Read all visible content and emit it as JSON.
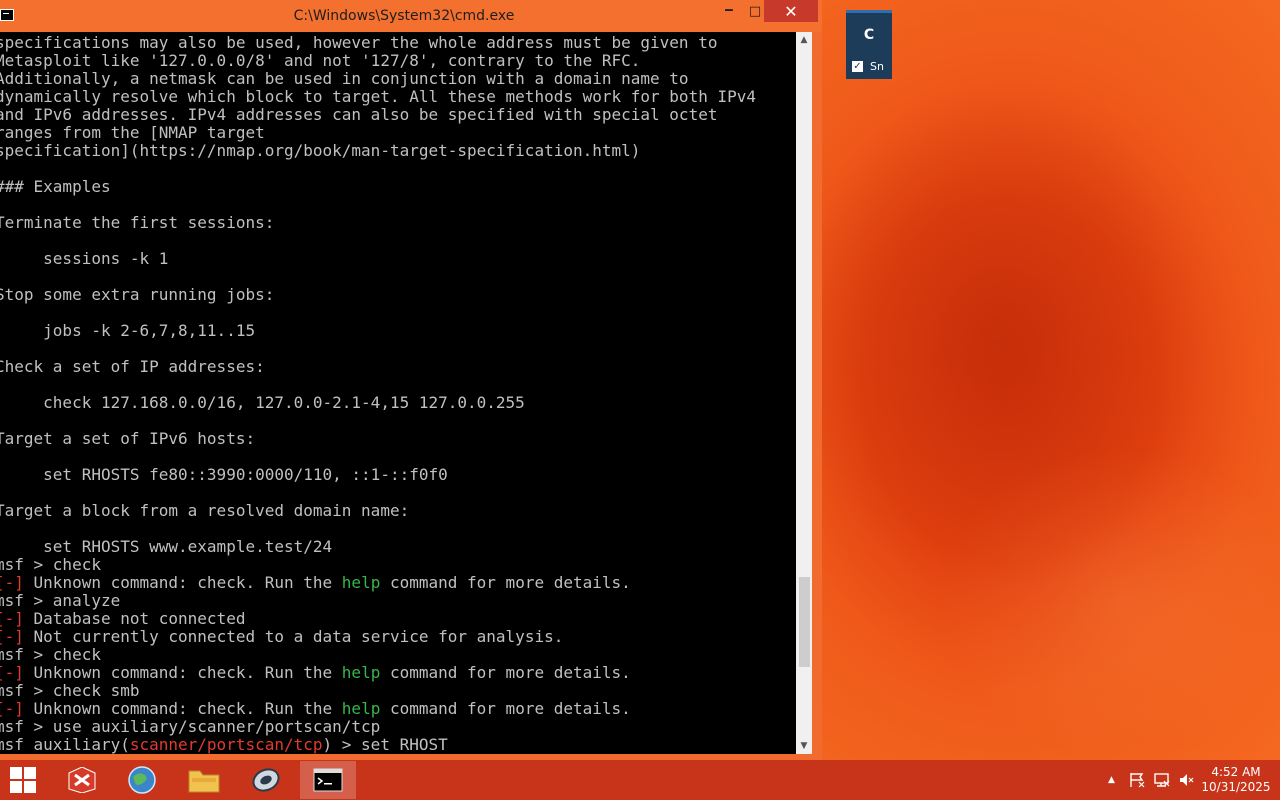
{
  "window": {
    "title": "C:\\Windows\\System32\\cmd.exe",
    "minimize_glyph": "🗕",
    "maximize_glyph": "□",
    "close_glyph": "✕"
  },
  "console_lines": [
    [
      {
        "t": "specifications may also be used, however the whole address must be given to"
      }
    ],
    [
      {
        "t": "Metasploit like '127.0.0.0/8' and not '127/8', contrary to the RFC."
      }
    ],
    [
      {
        "t": "Additionally, a netmask can be used in conjunction with a domain name to"
      }
    ],
    [
      {
        "t": "dynamically resolve which block to target. All these methods work for both IPv4"
      }
    ],
    [
      {
        "t": "and IPv6 addresses. IPv4 addresses can also be specified with special octet"
      }
    ],
    [
      {
        "t": "ranges from the [NMAP target"
      }
    ],
    [
      {
        "t": "specification](https://nmap.org/book/man-target-specification.html)"
      }
    ],
    [
      {
        "t": ""
      }
    ],
    [
      {
        "t": "### Examples"
      }
    ],
    [
      {
        "t": ""
      }
    ],
    [
      {
        "t": "Terminate the first sessions:"
      }
    ],
    [
      {
        "t": ""
      }
    ],
    [
      {
        "t": "     sessions -k 1"
      }
    ],
    [
      {
        "t": ""
      }
    ],
    [
      {
        "t": "Stop some extra running jobs:"
      }
    ],
    [
      {
        "t": ""
      }
    ],
    [
      {
        "t": "     jobs -k 2-6,7,8,11..15"
      }
    ],
    [
      {
        "t": ""
      }
    ],
    [
      {
        "t": "Check a set of IP addresses:"
      }
    ],
    [
      {
        "t": ""
      }
    ],
    [
      {
        "t": "     check 127.168.0.0/16, 127.0.0-2.1-4,15 127.0.0.255"
      }
    ],
    [
      {
        "t": ""
      }
    ],
    [
      {
        "t": "Target a set of IPv6 hosts:"
      }
    ],
    [
      {
        "t": ""
      }
    ],
    [
      {
        "t": "     set RHOSTS fe80::3990:0000/110, ::1-::f0f0"
      }
    ],
    [
      {
        "t": ""
      }
    ],
    [
      {
        "t": "Target a block from a resolved domain name:"
      }
    ],
    [
      {
        "t": ""
      }
    ],
    [
      {
        "t": "     set RHOSTS www.example.test/24"
      }
    ],
    [
      {
        "t": "msf > check"
      }
    ],
    [
      {
        "t": "[-]",
        "c": "red"
      },
      {
        "t": " Unknown command: check. Run the "
      },
      {
        "t": "help",
        "c": "green"
      },
      {
        "t": " command for more details."
      }
    ],
    [
      {
        "t": "msf > analyze"
      }
    ],
    [
      {
        "t": "[-]",
        "c": "red"
      },
      {
        "t": " Database not connected"
      }
    ],
    [
      {
        "t": "[-]",
        "c": "red"
      },
      {
        "t": " Not currently connected to a data service for analysis."
      }
    ],
    [
      {
        "t": "msf > check"
      }
    ],
    [
      {
        "t": "[-]",
        "c": "red"
      },
      {
        "t": " Unknown command: check. Run the "
      },
      {
        "t": "help",
        "c": "green"
      },
      {
        "t": " command for more details."
      }
    ],
    [
      {
        "t": "msf > check smb"
      }
    ],
    [
      {
        "t": "[-]",
        "c": "red"
      },
      {
        "t": " Unknown command: check. Run the "
      },
      {
        "t": "help",
        "c": "green"
      },
      {
        "t": " command for more details."
      }
    ],
    [
      {
        "t": "msf > use auxiliary/scanner/portscan/tcp"
      }
    ],
    [
      {
        "t": "msf auxiliary("
      },
      {
        "t": "scanner/portscan/tcp",
        "c": "red"
      },
      {
        "t": ") > set RHOST"
      }
    ]
  ],
  "notification": {
    "title": "C",
    "check_glyph": "✓",
    "label": "Sn"
  },
  "taskbar": {
    "items": [
      "start",
      "ftp-app",
      "browser",
      "file-explorer",
      "network-app",
      "cmd"
    ],
    "active": "cmd"
  },
  "tray": {
    "chevron": "▲",
    "time": "4:52 AM",
    "date": "10/31/2025"
  },
  "colors": {
    "accent": "#f4702f",
    "taskbar": "#c8341a",
    "console_bg": "#000000",
    "console_text": "#c0c0c0",
    "help_green": "#39b54a",
    "error_red": "#e23b2e"
  }
}
